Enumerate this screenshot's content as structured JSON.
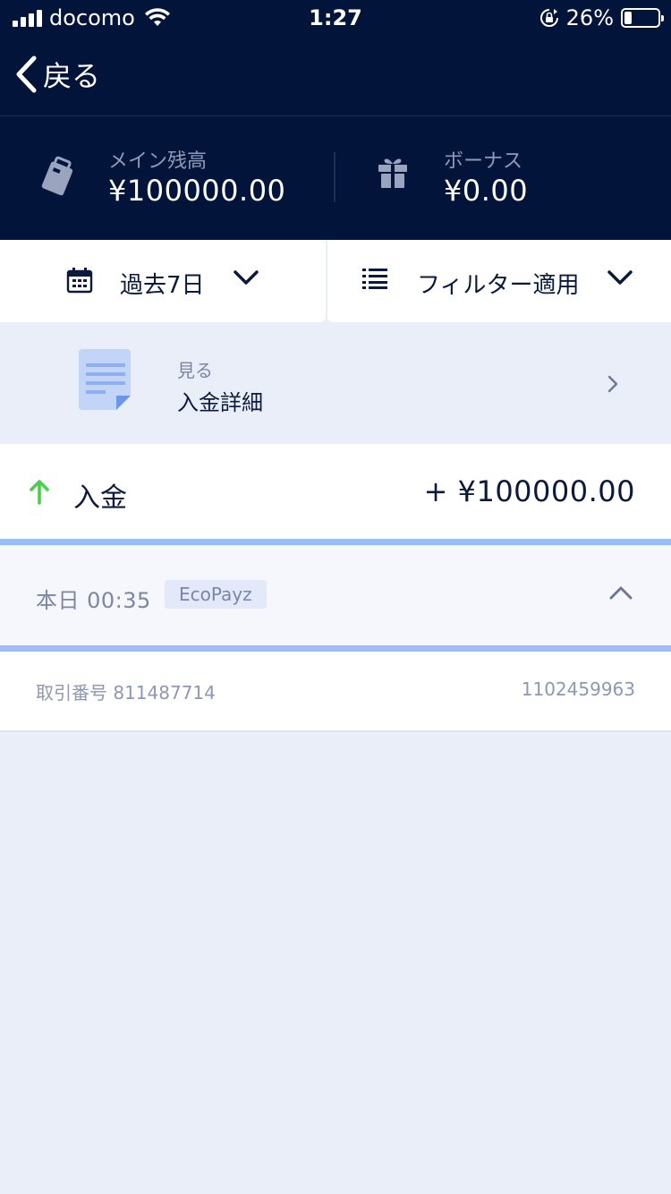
{
  "status_bar": {
    "carrier": "docomo",
    "time": "1:27",
    "battery": "26%",
    "battery_level": 0.26,
    "icons": [
      "signal-icon",
      "wifi-icon",
      "rotation-lock-icon",
      "battery-icon"
    ]
  },
  "nav": {
    "back_label": "戻る",
    "back_icon": "chevron-left-icon"
  },
  "balances": {
    "main": {
      "label": "メイン残高",
      "value": "¥100000.00",
      "icon": "wallet-icon"
    },
    "bonus": {
      "label": "ボーナス",
      "value": "¥0.00",
      "icon": "gift-icon"
    }
  },
  "filters": {
    "date": {
      "label": "過去7日",
      "icon": "calendar-icon"
    },
    "apply": {
      "label": "フィルター適用",
      "icon": "list-icon"
    }
  },
  "details_link": {
    "small": "見る",
    "main": "入金詳細",
    "icon": "document-icon"
  },
  "transaction": {
    "type": "入金",
    "amount": "+ ¥100000.00",
    "time": "本日 00:35",
    "method": "EcoPayz",
    "id_label": "取引番号 811487714",
    "id_value": "1102459963"
  },
  "colors": {
    "header_bg": "#03143a",
    "page_bg": "#e9eef9",
    "accent_blue": "#9bbcf6",
    "deposit_green": "#4cce4c",
    "text_dark": "#0b1a3c",
    "text_muted": "#7b86a6"
  }
}
